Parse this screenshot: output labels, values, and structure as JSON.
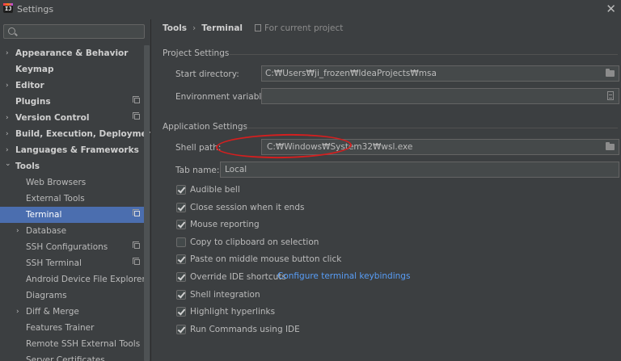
{
  "window": {
    "title": "Settings",
    "app_icon_text": "IJ"
  },
  "search": {
    "value": "",
    "placeholder": ""
  },
  "sidebar": {
    "items": [
      {
        "label": "Appearance & Behavior",
        "arrow": "›"
      },
      {
        "label": "Keymap"
      },
      {
        "label": "Editor",
        "arrow": "›"
      },
      {
        "label": "Plugins"
      },
      {
        "label": "Version Control",
        "arrow": "›"
      },
      {
        "label": "Build, Execution, Deployment",
        "arrow": "›"
      },
      {
        "label": "Languages & Frameworks",
        "arrow": "›"
      },
      {
        "label": "Tools",
        "arrow": "⌄"
      },
      {
        "label": "Web Browsers"
      },
      {
        "label": "External Tools"
      },
      {
        "label": "Terminal"
      },
      {
        "label": "Database",
        "arrow": "›"
      },
      {
        "label": "SSH Configurations"
      },
      {
        "label": "SSH Terminal"
      },
      {
        "label": "Android Device File Explorer"
      },
      {
        "label": "Diagrams"
      },
      {
        "label": "Diff & Merge",
        "arrow": "›"
      },
      {
        "label": "Features Trainer"
      },
      {
        "label": "Remote SSH External Tools"
      },
      {
        "label": "Server Certificates"
      }
    ]
  },
  "breadcrumb": {
    "parent": "Tools",
    "separator": "›",
    "current": "Terminal",
    "scope": "For current project"
  },
  "project_settings": {
    "title": "Project Settings",
    "start_dir_label": "Start directory:",
    "start_dir_value": "C:₩Users₩ji_frozen₩IdeaProjects₩msa",
    "env_label": "Environment variables:",
    "env_value": ""
  },
  "app_settings": {
    "title": "Application Settings",
    "shell_label": "Shell path:",
    "shell_value": "C:₩Windows₩System32₩wsl.exe",
    "tab_label": "Tab name:",
    "tab_value": "Local"
  },
  "options": [
    {
      "label": "Audible bell",
      "checked": true
    },
    {
      "label": "Close session when it ends",
      "checked": true
    },
    {
      "label": "Mouse reporting",
      "checked": true
    },
    {
      "label": "Copy to clipboard on selection",
      "checked": false
    },
    {
      "label": "Paste on middle mouse button click",
      "checked": true
    },
    {
      "label": "Override IDE shortcuts",
      "checked": true
    },
    {
      "label": "Shell integration",
      "checked": true
    },
    {
      "label": "Highlight hyperlinks",
      "checked": true
    },
    {
      "label": "Run Commands using IDE",
      "checked": true
    }
  ],
  "configure_link": "Configure terminal keybindings",
  "colors": {
    "selection": "#4b6eaf",
    "link": "#589df6",
    "annotation": "#d41f1f"
  }
}
